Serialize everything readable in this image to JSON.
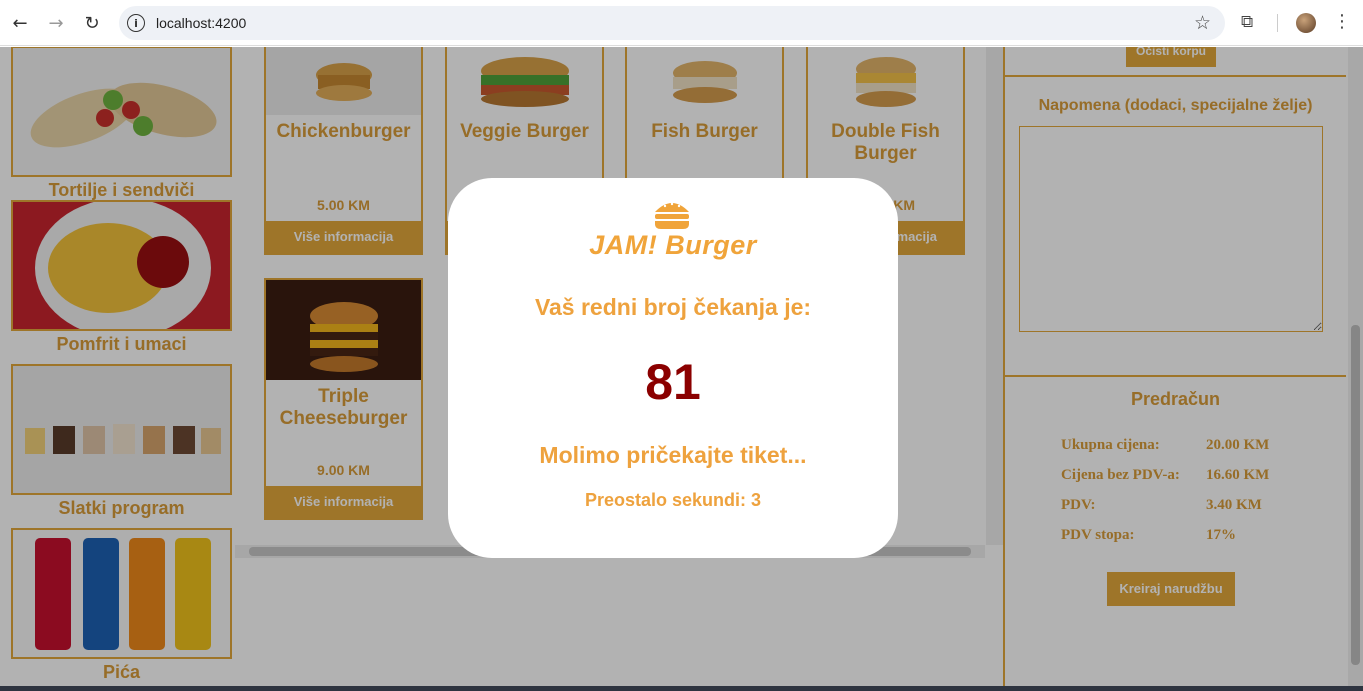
{
  "browser": {
    "url": "localhost:4200"
  },
  "categories": [
    {
      "label": "Tortilje i sendviči"
    },
    {
      "label": "Pomfrit i umaci"
    },
    {
      "label": "Slatki program"
    },
    {
      "label": "Pića"
    }
  ],
  "products": [
    {
      "name": "Chickenburger",
      "price": "5.00 KM",
      "more": "Više informacija"
    },
    {
      "name": "Veggie Burger"
    },
    {
      "name": "Fish Burger"
    },
    {
      "name": "Double Fish Burger",
      "price": "KM",
      "more": "macija"
    },
    {
      "name": "Triple Cheeseburger",
      "price": "9.00 KM",
      "more": "Više informacija"
    }
  ],
  "cart": {
    "clear_label": "Očisti korpu",
    "note_title": "Napomena (dodaci, specijalne želje)",
    "note_value": ""
  },
  "bill": {
    "title": "Predračun",
    "rows": [
      {
        "k": "Ukupna cijena:",
        "v": "20.00 KM"
      },
      {
        "k": "Cijena bez PDV-a:",
        "v": "16.60 KM"
      },
      {
        "k": "PDV:",
        "v": "3.40 KM"
      },
      {
        "k": "PDV stopa:",
        "v": "17%"
      }
    ],
    "order_label": "Kreiraj narudžbu"
  },
  "modal": {
    "logo_text": "JAM! Burger",
    "title": "Vaš redni broj čekanja je:",
    "number": "81",
    "wait_text": "Molimo pričekajte tiket...",
    "seconds_text": "Preostalo sekundi: 3"
  }
}
